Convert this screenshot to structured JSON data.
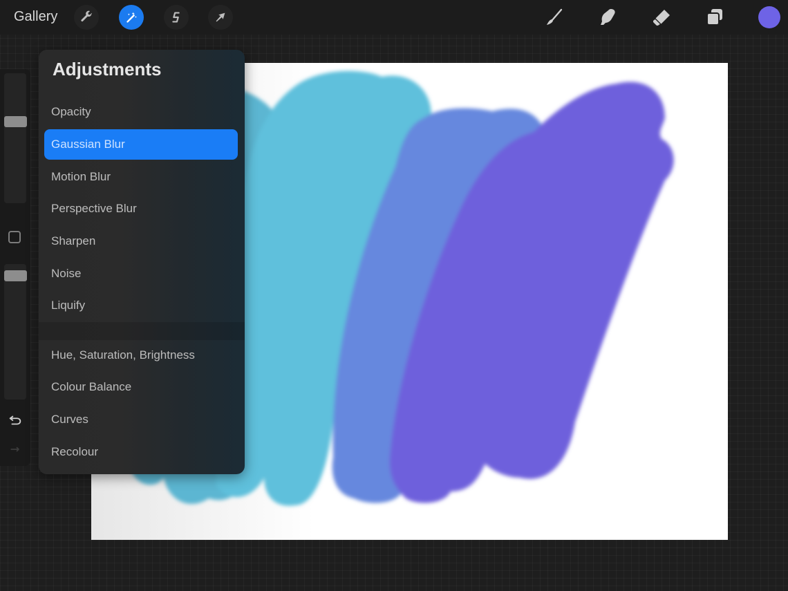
{
  "topbar": {
    "gallery_label": "Gallery",
    "left_tools": [
      {
        "name": "actions",
        "icon": "wrench-icon",
        "active": false
      },
      {
        "name": "adjustments",
        "icon": "magic-wand-icon",
        "active": true
      },
      {
        "name": "selection",
        "icon": "selection-s-icon",
        "active": false
      },
      {
        "name": "transform",
        "icon": "arrow-cursor-icon",
        "active": false
      }
    ],
    "right_tools": [
      {
        "name": "brush",
        "icon": "brush-icon"
      },
      {
        "name": "smudge",
        "icon": "smudge-finger-icon"
      },
      {
        "name": "eraser",
        "icon": "eraser-icon"
      },
      {
        "name": "layers",
        "icon": "layers-icon"
      }
    ],
    "current_color": "#6e63e6"
  },
  "sidebar": {
    "brush_size_level": 0.64,
    "brush_opacity_level": 0.95,
    "undo_icon": "undo-arrow-icon",
    "redo_icon": "redo-arrow-icon"
  },
  "adjustments": {
    "title": "Adjustments",
    "group1": [
      {
        "label": "Opacity",
        "selected": false
      },
      {
        "label": "Gaussian Blur",
        "selected": true
      },
      {
        "label": "Motion Blur",
        "selected": false
      },
      {
        "label": "Perspective Blur",
        "selected": false
      },
      {
        "label": "Sharpen",
        "selected": false
      },
      {
        "label": "Noise",
        "selected": false
      },
      {
        "label": "Liquify",
        "selected": false
      }
    ],
    "group2": [
      {
        "label": "Hue, Saturation, Brightness",
        "selected": false
      },
      {
        "label": "Colour Balance",
        "selected": false
      },
      {
        "label": "Curves",
        "selected": false
      },
      {
        "label": "Recolour",
        "selected": false
      }
    ]
  },
  "canvas": {
    "background": "#ffffff",
    "strokes": [
      {
        "name": "teal-stroke",
        "color": "#5bb6d2"
      },
      {
        "name": "cyan-stroke",
        "color": "#5fc0dc"
      },
      {
        "name": "blue-stroke",
        "color": "#6688de"
      },
      {
        "name": "purple-stroke",
        "color": "#6e60dc"
      }
    ]
  },
  "accent_color": "#1a7df6"
}
